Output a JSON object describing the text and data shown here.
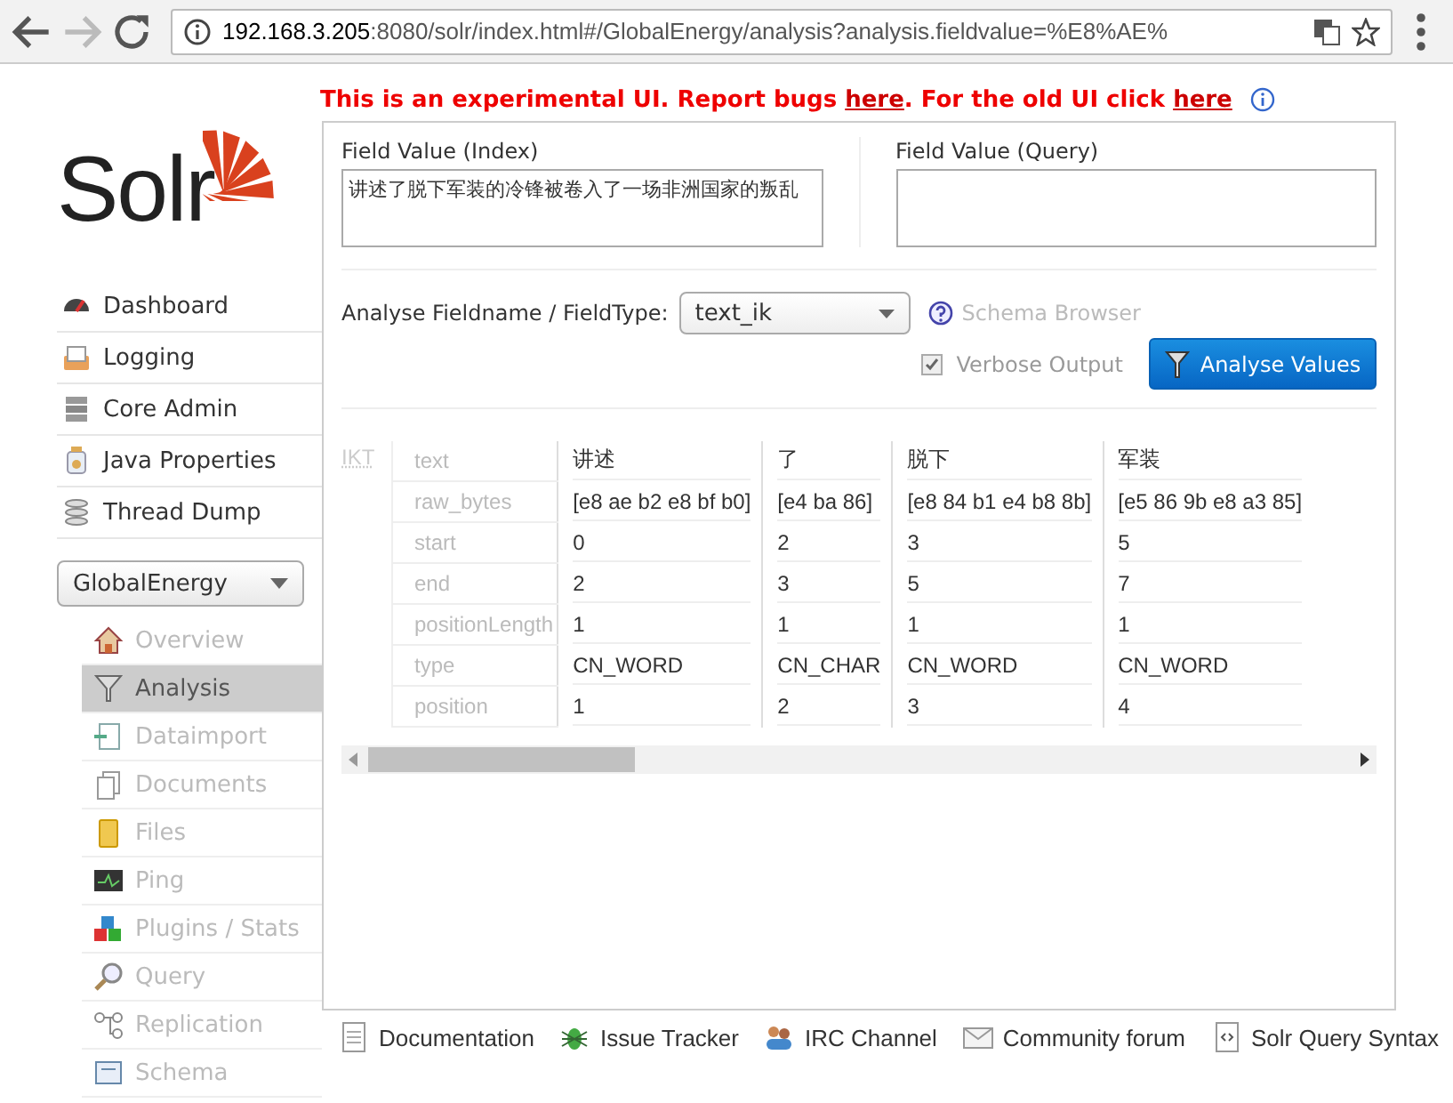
{
  "browser": {
    "url_host": "192.168.3.205",
    "url_rest": ":8080/solr/index.html#/GlobalEnergy/analysis?analysis.fieldvalue=%E8%AE%"
  },
  "banner": [
    {
      "kind": "text",
      "text": "This is an experimental UI. Report bugs "
    },
    {
      "kind": "link",
      "text": "here"
    },
    {
      "kind": "text",
      "text": ". For the old UI click "
    },
    {
      "kind": "link",
      "text": "here"
    }
  ],
  "logo": "Solr",
  "sidebar": {
    "items": [
      {
        "label": "Dashboard"
      },
      {
        "label": "Logging"
      },
      {
        "label": "Core Admin"
      },
      {
        "label": "Java Properties"
      },
      {
        "label": "Thread Dump"
      }
    ],
    "core_selector": "GlobalEnergy",
    "core_items": [
      {
        "label": "Overview",
        "selected": false
      },
      {
        "label": "Analysis",
        "selected": true
      },
      {
        "label": "Dataimport",
        "selected": false
      },
      {
        "label": "Documents",
        "selected": false
      },
      {
        "label": "Files",
        "selected": false
      },
      {
        "label": "Ping",
        "selected": false
      },
      {
        "label": "Plugins / Stats",
        "selected": false
      },
      {
        "label": "Query",
        "selected": false
      },
      {
        "label": "Replication",
        "selected": false
      },
      {
        "label": "Schema",
        "selected": false
      }
    ]
  },
  "form": {
    "index_label": "Field Value (Index)",
    "index_value": "讲述了脱下军装的冷锋被卷入了一场非洲国家的叛乱",
    "query_label": "Field Value (Query)",
    "fieldtype_label": "Analyse Fieldname / FieldType:",
    "fieldtype_value": "text_ik",
    "schema_browser": "Schema Browser",
    "verbose": {
      "label": "Verbose Output",
      "checked": true
    },
    "analyse_button": "Analyse Values"
  },
  "results": {
    "tokenizer": "IKT",
    "attributes": [
      "text",
      "raw_bytes",
      "start",
      "end",
      "positionLength",
      "type",
      "position"
    ],
    "tokens": [
      {
        "values": [
          "讲述",
          "[e8 ae b2 e8 bf b0]",
          "0",
          "2",
          "1",
          "CN_WORD",
          "1"
        ]
      },
      {
        "values": [
          "了",
          "[e4 ba 86]",
          "2",
          "3",
          "1",
          "CN_CHAR",
          "2"
        ]
      },
      {
        "values": [
          "脱下",
          "[e8 84 b1 e4 b8 8b]",
          "3",
          "5",
          "1",
          "CN_WORD",
          "3"
        ]
      },
      {
        "values": [
          "军装",
          "[e5 86 9b e8 a3 85]",
          "5",
          "7",
          "1",
          "CN_WORD",
          "4"
        ]
      }
    ]
  },
  "footer": [
    {
      "label": "Documentation"
    },
    {
      "label": "Issue Tracker"
    },
    {
      "label": "IRC Channel"
    },
    {
      "label": "Community forum"
    },
    {
      "label": "Solr Query Syntax"
    }
  ]
}
